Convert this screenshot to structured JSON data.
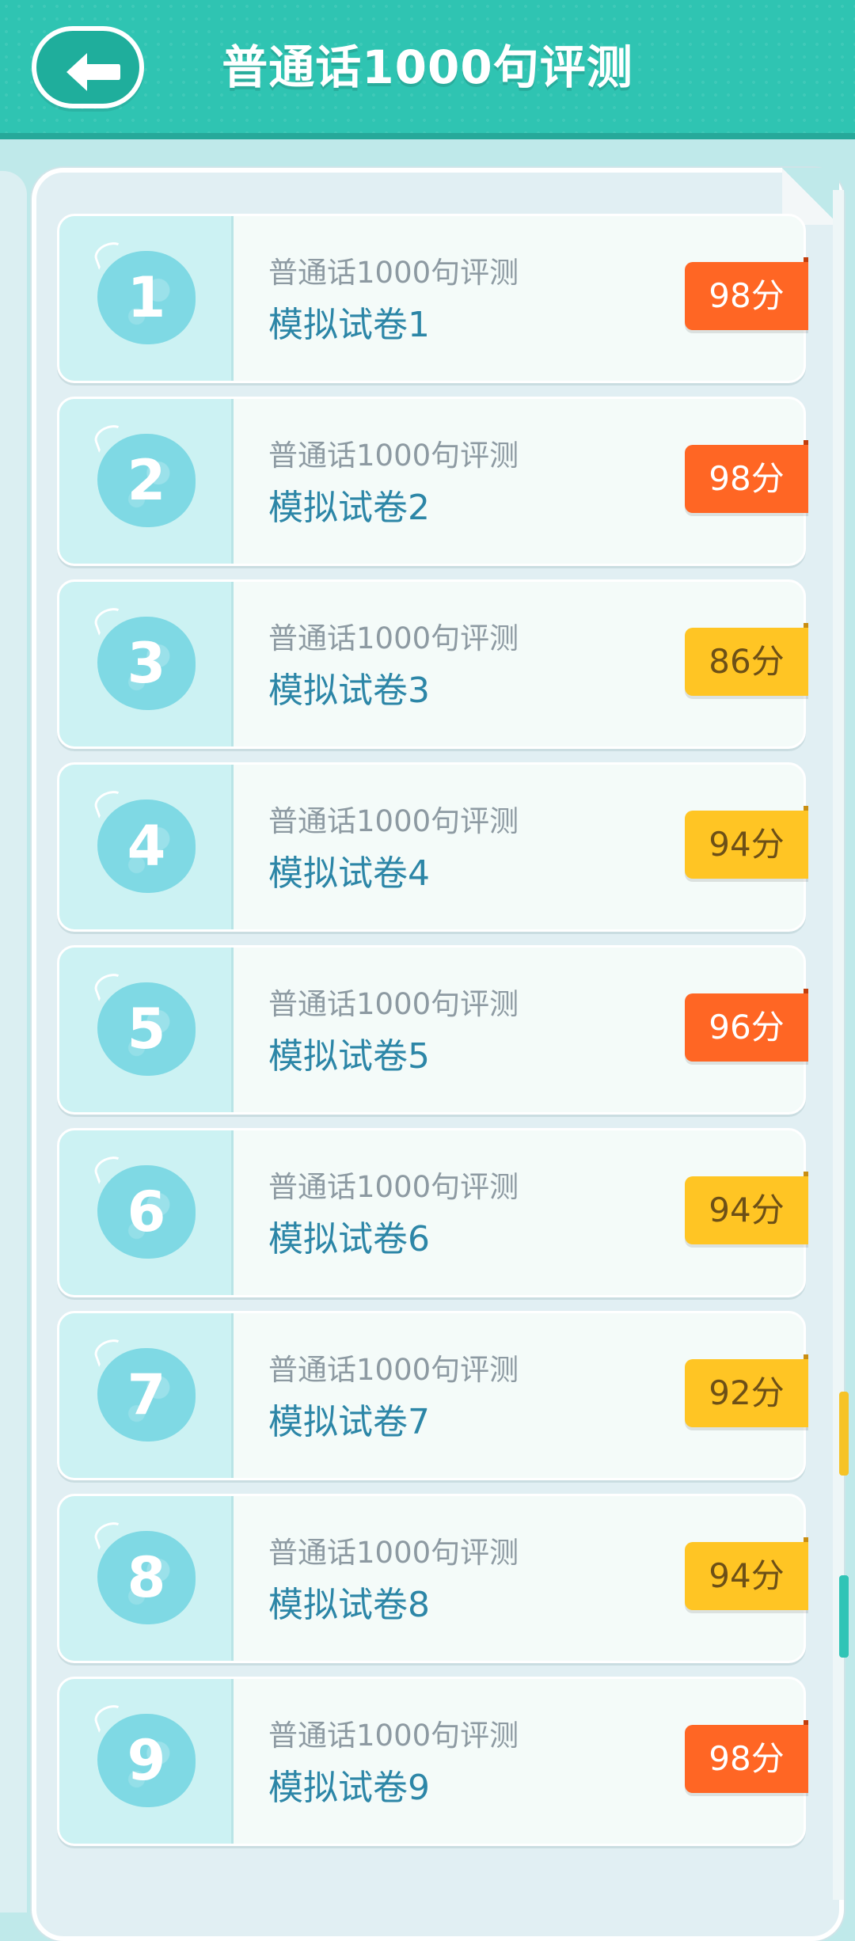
{
  "header": {
    "title": "普通话1000句评测",
    "back_icon": "arrow-left-icon"
  },
  "colors": {
    "header": "#2fc4b2",
    "high_score": "#ff6624",
    "mid_score": "#ffc524",
    "title_text": "#2c86a7"
  },
  "items": [
    {
      "number": "1",
      "subtitle": "普通话1000句评测",
      "title": "模拟试卷1",
      "score": "98分",
      "level": "high"
    },
    {
      "number": "2",
      "subtitle": "普通话1000句评测",
      "title": "模拟试卷2",
      "score": "98分",
      "level": "high"
    },
    {
      "number": "3",
      "subtitle": "普通话1000句评测",
      "title": "模拟试卷3",
      "score": "86分",
      "level": "mid"
    },
    {
      "number": "4",
      "subtitle": "普通话1000句评测",
      "title": "模拟试卷4",
      "score": "94分",
      "level": "mid"
    },
    {
      "number": "5",
      "subtitle": "普通话1000句评测",
      "title": "模拟试卷5",
      "score": "96分",
      "level": "high"
    },
    {
      "number": "6",
      "subtitle": "普通话1000句评测",
      "title": "模拟试卷6",
      "score": "94分",
      "level": "mid"
    },
    {
      "number": "7",
      "subtitle": "普通话1000句评测",
      "title": "模拟试卷7",
      "score": "92分",
      "level": "mid"
    },
    {
      "number": "8",
      "subtitle": "普通话1000句评测",
      "title": "模拟试卷8",
      "score": "94分",
      "level": "mid"
    },
    {
      "number": "9",
      "subtitle": "普通话1000句评测",
      "title": "模拟试卷9",
      "score": "98分",
      "level": "high"
    }
  ]
}
